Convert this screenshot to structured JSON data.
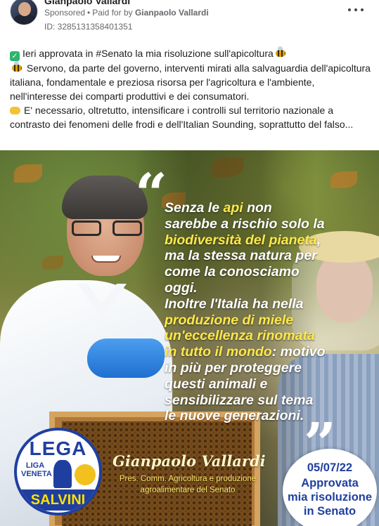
{
  "post": {
    "author": "Gianpaolo Vallardi",
    "sponsored": "Sponsored",
    "separator": "•",
    "paid_for_prefix": "Paid for by",
    "payer": "Gianpaolo Vallardi",
    "ad_id": "ID: 3285131358401351",
    "more_icon": "more-horizontal-icon"
  },
  "text": {
    "line1": "Ieri approvata in #Senato la mia risoluzione sull'apicoltura",
    "line2": "Servono, da parte del governo, interventi mirati alla salvaguardia dell'apicoltura",
    "line3": "italiana, fondamentale e preziosa risorsa per l'agricoltura e l'ambiente,",
    "line4": "nell'interesse dei comparti produttivi e dei consumatori.",
    "line5": "E' necessario, oltretutto, intensificare i controlli sul territorio nazionale a",
    "line6": "contrasto dei fenomeni delle frodi e dell'Italian Sounding, soprattutto del falso..."
  },
  "image": {
    "quote_open": "“",
    "quote_close": "”",
    "quote_lines": [
      {
        "pre": "Senza le ",
        "hl": "api",
        "post": " non"
      },
      {
        "pre": "sarebbe a rischio solo la",
        "hl": "",
        "post": ""
      },
      {
        "pre": "",
        "hl": "biodiversità del pianeta",
        "post": ","
      },
      {
        "pre": "ma la stessa natura per",
        "hl": "",
        "post": ""
      },
      {
        "pre": "come la conosciamo",
        "hl": "",
        "post": ""
      },
      {
        "pre": "oggi.",
        "hl": "",
        "post": ""
      },
      {
        "pre": "Inoltre l'Italia ha nella",
        "hl": "",
        "post": ""
      },
      {
        "pre": "",
        "hl": "produzione di miele",
        "post": ""
      },
      {
        "pre": "",
        "hl": "un'eccellenza rinomata",
        "post": ""
      },
      {
        "pre": "",
        "hl": "in tutto il mondo",
        "post": ": motivo"
      },
      {
        "pre": "in più per proteggere",
        "hl": "",
        "post": ""
      },
      {
        "pre": "questi animali e",
        "hl": "",
        "post": ""
      },
      {
        "pre": "sensibilizzare sul tema",
        "hl": "",
        "post": ""
      },
      {
        "pre": "le nuove generazioni.",
        "hl": "",
        "post": ""
      }
    ],
    "logo": {
      "top": "LEGA",
      "sub": "LIGA VENETA",
      "bottom": "SALVINI"
    },
    "signature": "Gianpaolo Vallardi",
    "role_line1": "Pres. Comm. Agricoltura e produzione",
    "role_line2": "agroalimentare del Senato",
    "badge": {
      "date": "05/07/22",
      "line2": "Approvata",
      "line3": "mia risoluzione",
      "line4": "in Senato"
    }
  },
  "colors": {
    "highlight": "#ffe94a",
    "lega_blue": "#1f3fa0",
    "check_green": "#2fb36d"
  }
}
